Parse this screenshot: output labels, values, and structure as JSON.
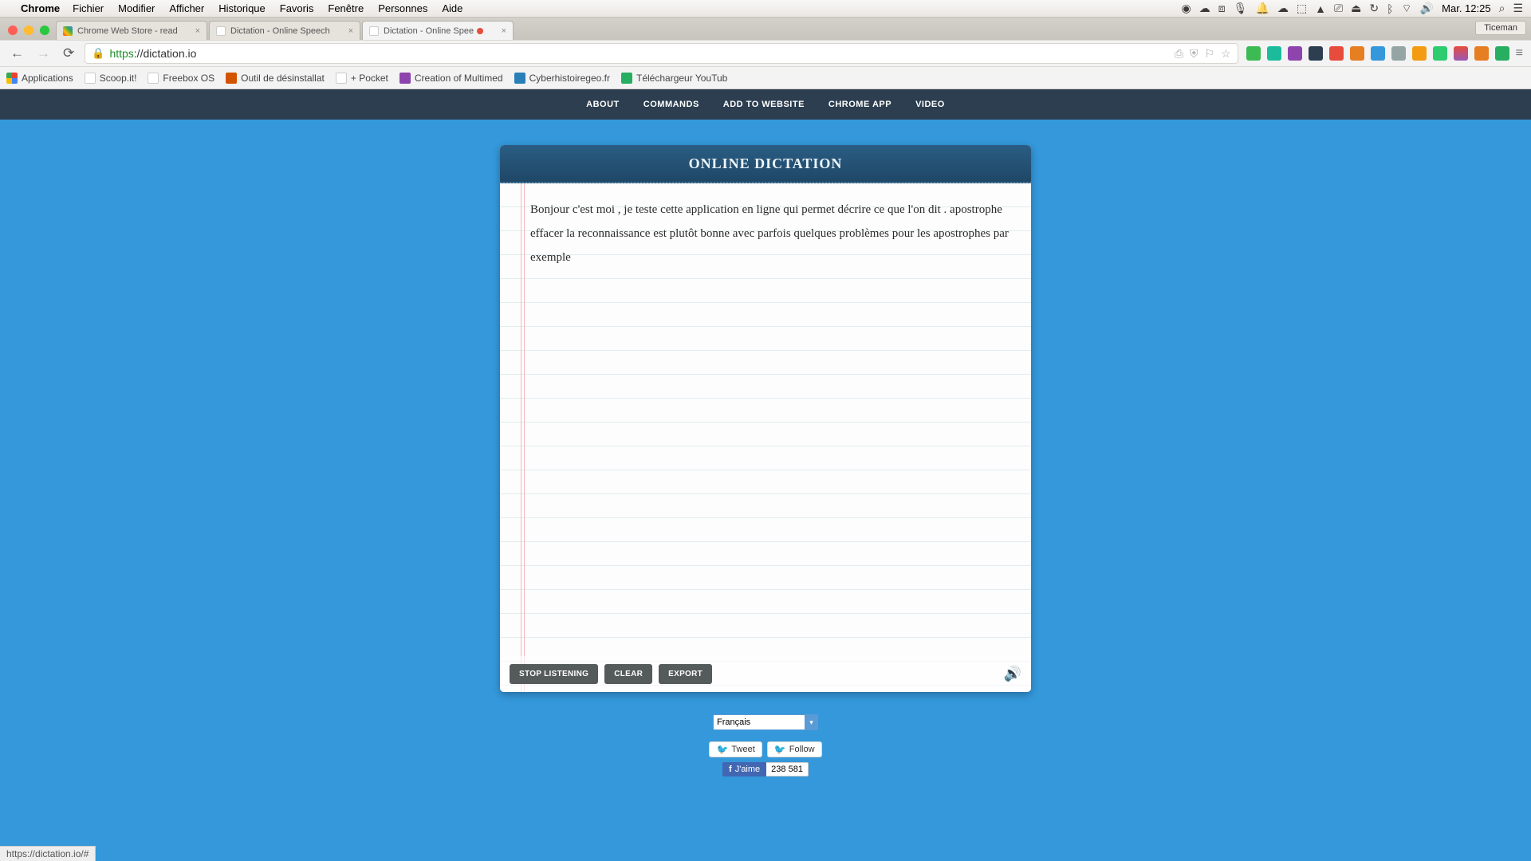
{
  "mac_menu": {
    "app": "Chrome",
    "items": [
      "Fichier",
      "Modifier",
      "Afficher",
      "Historique",
      "Favoris",
      "Fenêtre",
      "Personnes",
      "Aide"
    ],
    "clock": "Mar. 12:25"
  },
  "user_button": "Ticeman",
  "tabs": [
    {
      "title": "Chrome Web Store - read",
      "active": false
    },
    {
      "title": "Dictation - Online Speech",
      "active": false
    },
    {
      "title": "Dictation - Online Spee",
      "active": true
    }
  ],
  "url_secure": "https",
  "url_rest": "://dictation.io",
  "bookmarks": [
    "Applications",
    "Scoop.it!",
    "Freebox OS",
    "Outil de désinstallat",
    "+ Pocket",
    "Creation of Multimed",
    "Cyberhistoiregeo.fr",
    "Téléchargeur YouTub"
  ],
  "site_nav": [
    "ABOUT",
    "COMMANDS",
    "ADD TO WEBSITE",
    "CHROME APP",
    "VIDEO"
  ],
  "card_title": "ONLINE DICTATION",
  "dictated_text": "Bonjour c'est moi , je teste cette application en ligne qui permet décrire ce que l'on dit . apostrophe effacer la reconnaissance est plutôt bonne avec parfois quelques problèmes pour les apostrophes par exemple",
  "btn_stop": "STOP LISTENING",
  "btn_clear": "CLEAR",
  "btn_export": "EXPORT",
  "language": "Français",
  "tweet_label": "Tweet",
  "follow_label": "Follow",
  "fb_like": "J'aime",
  "fb_count": "238 581",
  "status_url": "https://dictation.io/#"
}
